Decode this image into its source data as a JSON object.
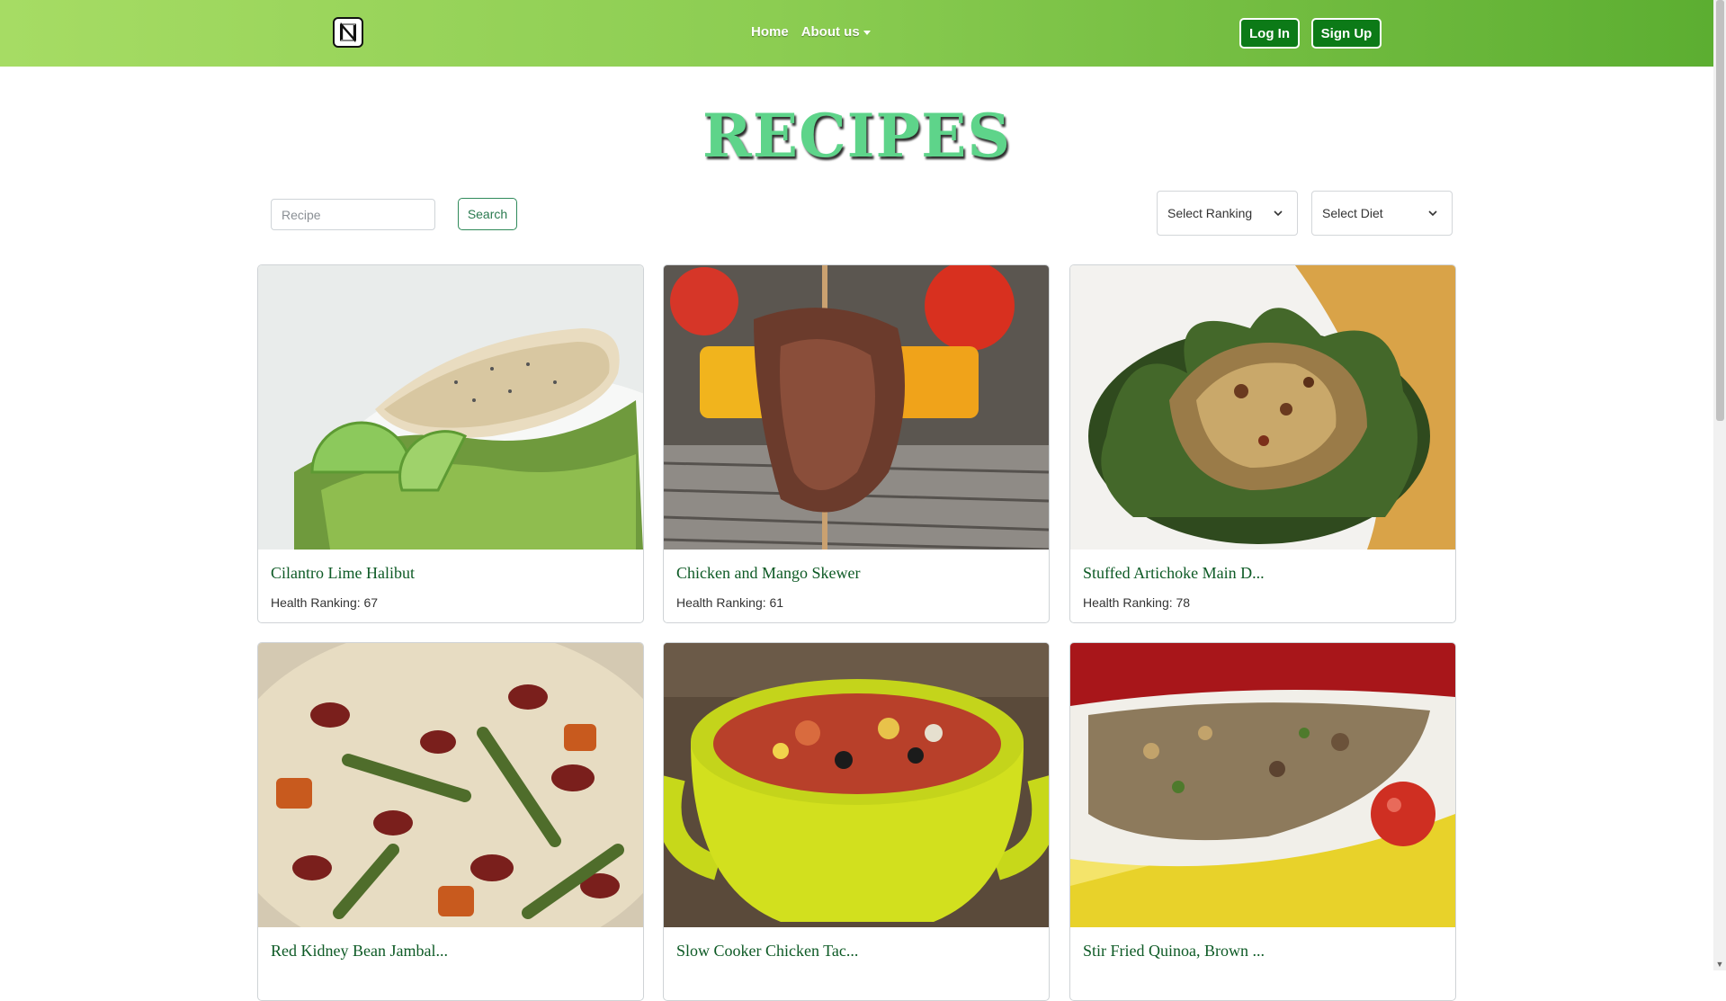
{
  "nav": {
    "home": "Home",
    "about": "About us",
    "login": "Log In",
    "signup": "Sign Up"
  },
  "page": {
    "title": "RECIPES"
  },
  "search": {
    "placeholder": "Recipe",
    "button": "Search"
  },
  "filters": {
    "ranking": "Select Ranking",
    "diet": "Select Diet"
  },
  "recipes": [
    {
      "title": "Cilantro Lime Halibut",
      "ranking": "Health Ranking: 67"
    },
    {
      "title": "Chicken and Mango Skewer",
      "ranking": "Health Ranking: 61"
    },
    {
      "title": "Stuffed Artichoke Main D...",
      "ranking": "Health Ranking: 78"
    },
    {
      "title": "Red Kidney Bean Jambal...",
      "ranking": ""
    },
    {
      "title": "Slow Cooker Chicken Tac...",
      "ranking": ""
    },
    {
      "title": "Stir Fried Quinoa, Brown ...",
      "ranking": ""
    }
  ],
  "colors": {
    "nav_gradient_start": "#a6dc64",
    "nav_gradient_end": "#5cae31",
    "button_green": "#0c7a17",
    "title_green": "#5ed48a",
    "card_title": "#0d5a25"
  }
}
